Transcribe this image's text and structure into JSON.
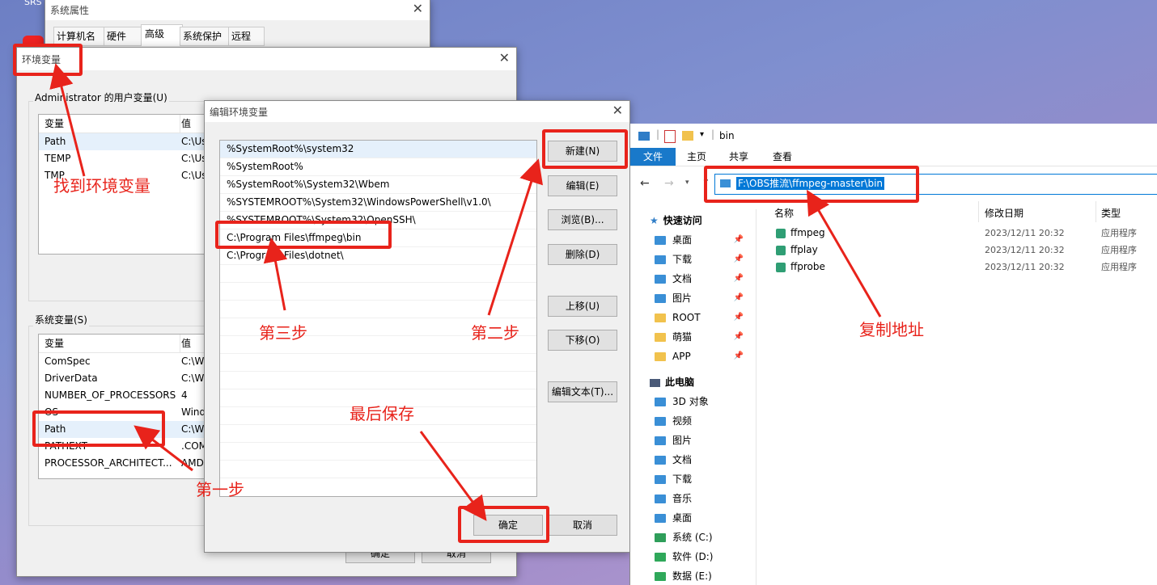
{
  "desktop": {
    "corner_text": "SRS"
  },
  "sysprops": {
    "title": "系统属性",
    "tabs": [
      "计算机名",
      "硬件",
      "高级",
      "系统保护",
      "远程"
    ]
  },
  "envvars": {
    "title": "环境变量",
    "user_group": "Administrator 的用户变量(U)",
    "user_cols": [
      "变量",
      "值"
    ],
    "user_rows": [
      [
        "Path",
        "C:\\Us"
      ],
      [
        "TEMP",
        "C:\\Us"
      ],
      [
        "TMP",
        "C:\\Us"
      ]
    ],
    "sys_group": "系统变量(S)",
    "sys_cols": [
      "变量",
      "值"
    ],
    "sys_rows": [
      [
        "ComSpec",
        "C:\\Wi"
      ],
      [
        "DriverData",
        "C:\\Wi"
      ],
      [
        "NUMBER_OF_PROCESSORS",
        "4"
      ],
      [
        "OS",
        "Wind"
      ],
      [
        "Path",
        "C:\\Wi"
      ],
      [
        "PATHEXT",
        ".COM"
      ],
      [
        "PROCESSOR_ARCHITECT...",
        "AMD"
      ]
    ],
    "ok": "确定",
    "cancel": "取消"
  },
  "editenv": {
    "title": "编辑环境变量",
    "entries": [
      "%SystemRoot%\\system32",
      "%SystemRoot%",
      "%SystemRoot%\\System32\\Wbem",
      "%SYSTEMROOT%\\System32\\WindowsPowerShell\\v1.0\\",
      "%SYSTEMROOT%\\System32\\OpenSSH\\",
      "C:\\Program Files\\ffmpeg\\bin",
      "C:\\Program Files\\dotnet\\"
    ],
    "buttons": {
      "new": "新建(N)",
      "edit": "编辑(E)",
      "browse": "浏览(B)...",
      "delete": "删除(D)",
      "up": "上移(U)",
      "down": "下移(O)",
      "edit_text": "编辑文本(T)...",
      "ok": "确定",
      "cancel": "取消"
    }
  },
  "explorer": {
    "title": "bin",
    "ribbon_tabs": [
      "文件",
      "主页",
      "共享",
      "查看"
    ],
    "address": "F:\\OBS推流\\ffmpeg-master\\bin",
    "columns": [
      "名称",
      "修改日期",
      "类型"
    ],
    "files": [
      {
        "name": "ffmpeg",
        "date": "2023/12/11 20:32",
        "type": "应用程序"
      },
      {
        "name": "ffplay",
        "date": "2023/12/11 20:32",
        "type": "应用程序"
      },
      {
        "name": "ffprobe",
        "date": "2023/12/11 20:32",
        "type": "应用程序"
      }
    ],
    "quick_access": "快速访问",
    "quick_items": [
      "桌面",
      "下载",
      "文档",
      "图片",
      "ROOT",
      "萌猫",
      "APP"
    ],
    "this_pc": "此电脑",
    "pc_items": [
      "3D 对象",
      "视频",
      "图片",
      "文档",
      "下载",
      "音乐",
      "桌面",
      "系统 (C:)",
      "软件 (D:)",
      "数据 (E:)"
    ]
  },
  "annotations": {
    "find_env": "找到环境变量",
    "step1": "第一步",
    "step2": "第二步",
    "step3": "第三步",
    "save": "最后保存",
    "copy_addr": "复制地址"
  },
  "colors": {
    "annotation_red": "#e8231b",
    "explorer_blue": "#1979ca",
    "select_blue": "#0078d7"
  }
}
